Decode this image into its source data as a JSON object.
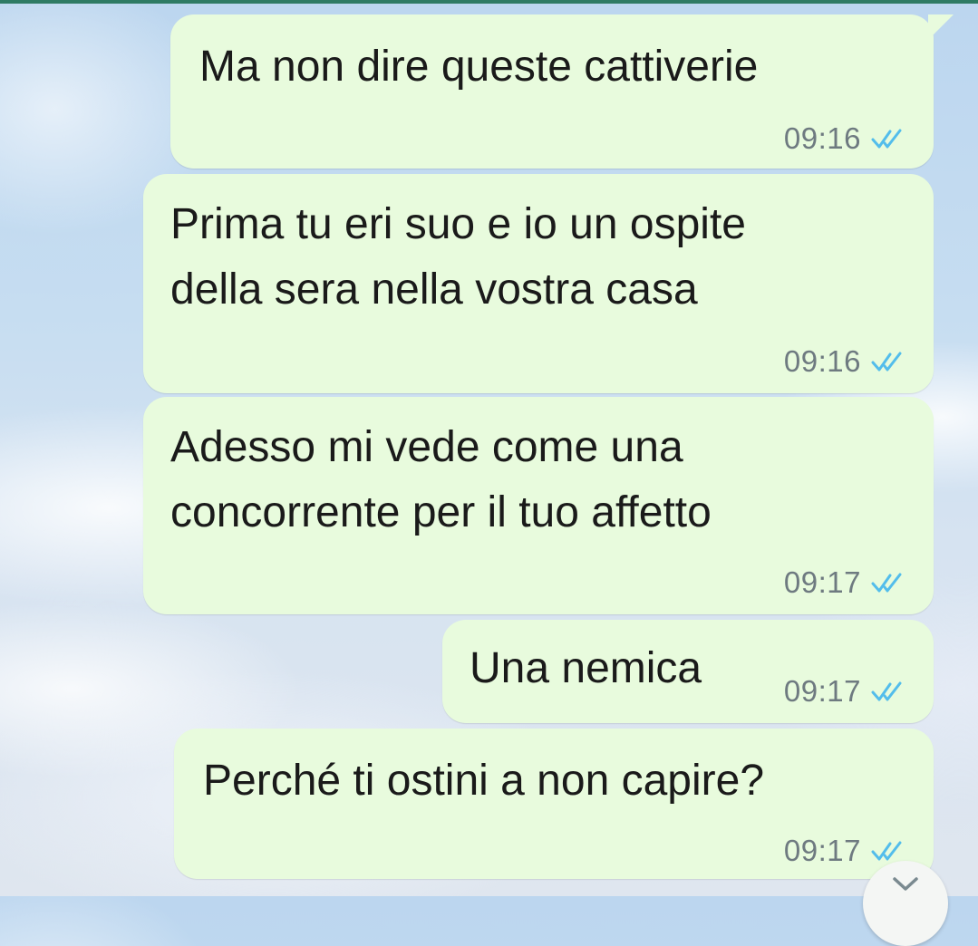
{
  "chat": {
    "messages": [
      {
        "text": "Ma non dire queste cattiverie",
        "time": "09:16",
        "status": "read"
      },
      {
        "text": "Prima tu eri suo e io un ospite\ndella sera nella vostra casa",
        "time": "09:16",
        "status": "read"
      },
      {
        "text": "Adesso mi vede come una\nconcorrente per il tuo affetto",
        "time": "09:17",
        "status": "read"
      },
      {
        "text": "Una nemica",
        "time": "09:17",
        "status": "read"
      },
      {
        "text": "Perché ti ostini a non capire?",
        "time": "09:17",
        "status": "read"
      }
    ],
    "read_tick_color": "#53bdeb",
    "outgoing_bubble_color": "#e8fbdd"
  },
  "icons": {
    "read_receipt": "double-check-icon",
    "scroll_down": "chevron-down-icon"
  }
}
